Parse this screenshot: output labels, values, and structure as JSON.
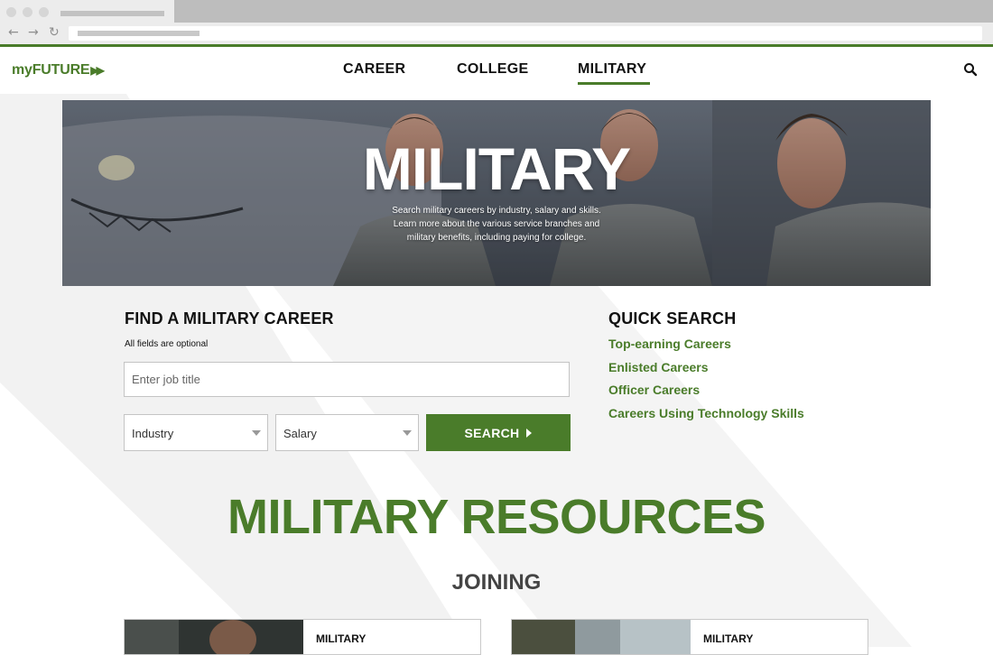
{
  "site": {
    "logo_text": "myFUTURE",
    "brand_color": "#4a7c2a",
    "search_icon": "search-icon"
  },
  "nav": {
    "items": [
      {
        "label": "CAREER",
        "active": false
      },
      {
        "label": "COLLEGE",
        "active": false
      },
      {
        "label": "MILITARY",
        "active": true
      }
    ]
  },
  "hero": {
    "title": "MILITARY",
    "subtitle_lines": [
      "Search military careers by industry, salary and skills.",
      "Learn more about the various service branches and",
      "military benefits, including paying for college."
    ]
  },
  "find_career": {
    "title": "FIND A MILITARY CAREER",
    "note": "All fields are optional",
    "job_placeholder": "Enter job title",
    "industry_label": "Industry",
    "salary_label": "Salary",
    "search_label": "SEARCH"
  },
  "quick_search": {
    "title": "QUICK SEARCH",
    "links": [
      "Top-earning Careers",
      "Enlisted Careers",
      "Officer Careers",
      "Careers Using Technology Skills"
    ]
  },
  "resources": {
    "title": "MILITARY RESOURCES",
    "section": "JOINING",
    "cards": [
      {
        "label": "MILITARY"
      },
      {
        "label": "MILITARY"
      }
    ]
  }
}
